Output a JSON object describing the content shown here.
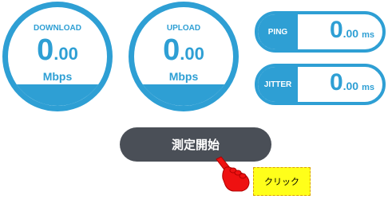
{
  "colors": {
    "accent": "#2e9fd4",
    "button_bg": "#4a4f57",
    "callout_bg": "#ffff1a",
    "hand": "#ee1111"
  },
  "download": {
    "label": "DOWNLOAD",
    "value_int": "0",
    "value_dec": ".00",
    "unit": "Mbps"
  },
  "upload": {
    "label": "UPLOAD",
    "value_int": "0",
    "value_dec": ".00",
    "unit": "Mbps"
  },
  "ping": {
    "label": "PING",
    "value_int": "0",
    "value_dec": ".00",
    "unit": "ms"
  },
  "jitter": {
    "label": "JITTER",
    "value_int": "0",
    "value_dec": ".00",
    "unit": "ms"
  },
  "start_button": {
    "label": "測定開始"
  },
  "annotation": {
    "label": "クリック",
    "icon": "pointing-hand-icon"
  }
}
